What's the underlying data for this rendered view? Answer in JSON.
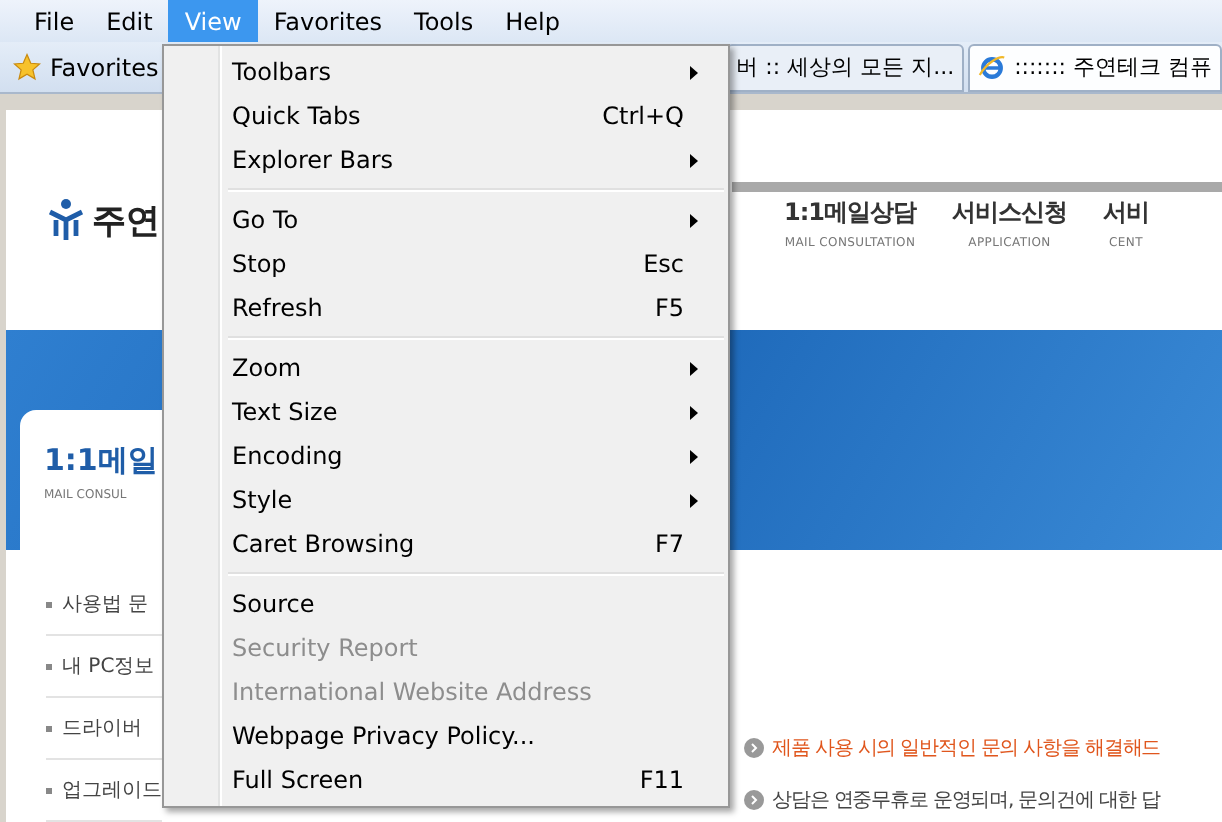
{
  "menu_bar": [
    {
      "label": "File",
      "selected": false
    },
    {
      "label": "Edit",
      "selected": false
    },
    {
      "label": "View",
      "selected": true
    },
    {
      "label": "Favorites",
      "selected": false
    },
    {
      "label": "Tools",
      "selected": false
    },
    {
      "label": "Help",
      "selected": false
    }
  ],
  "favorites_bar": {
    "label": "Favorites"
  },
  "tabs": [
    {
      "title": "버 :: 세상의 모든 지...",
      "selected": false
    },
    {
      "title": "::::::: 주연테크 컴퓨",
      "selected": true
    }
  ],
  "page": {
    "logo": "주연",
    "nav": [
      {
        "title": "1:1메일상담",
        "subtitle": "MAIL CONSULTATION"
      },
      {
        "title": "서비스신청",
        "subtitle": "APPLICATION"
      },
      {
        "title": "서비",
        "subtitle": "CENT"
      }
    ],
    "side_title": "1:1메일",
    "side_subtitle": "MAIL CONSUL",
    "side_links": [
      "사용법 문",
      "내 PC정보",
      "드라이버",
      "업그레이드"
    ],
    "notices": [
      {
        "text": "제품 사용 시의 일반적인 문의 사항을 해결해드",
        "highlight": true
      },
      {
        "text": "상담은 연중무휴로 운영되며, 문의건에 대한 답",
        "highlight": false
      }
    ]
  },
  "view_menu": [
    [
      {
        "label": "Toolbars",
        "submenu": true,
        "disabled": false
      },
      {
        "label": "Quick Tabs",
        "shortcut": "Ctrl+Q",
        "submenu": false,
        "disabled": false
      },
      {
        "label": "Explorer Bars",
        "submenu": true,
        "disabled": false
      }
    ],
    [
      {
        "label": "Go To",
        "submenu": true,
        "disabled": false
      },
      {
        "label": "Stop",
        "shortcut": "Esc",
        "submenu": false,
        "disabled": false
      },
      {
        "label": "Refresh",
        "shortcut": "F5",
        "submenu": false,
        "disabled": false
      }
    ],
    [
      {
        "label": "Zoom",
        "submenu": true,
        "disabled": false
      },
      {
        "label": "Text Size",
        "submenu": true,
        "disabled": false
      },
      {
        "label": "Encoding",
        "submenu": true,
        "disabled": false
      },
      {
        "label": "Style",
        "submenu": true,
        "disabled": false
      },
      {
        "label": "Caret Browsing",
        "shortcut": "F7",
        "submenu": false,
        "disabled": false
      }
    ],
    [
      {
        "label": "Source",
        "submenu": false,
        "disabled": false
      },
      {
        "label": "Security Report",
        "submenu": false,
        "disabled": true
      },
      {
        "label": "International Website Address",
        "submenu": false,
        "disabled": true
      },
      {
        "label": "Webpage Privacy Policy...",
        "submenu": false,
        "disabled": false
      },
      {
        "label": "Full Screen",
        "shortcut": "F11",
        "submenu": false,
        "disabled": false
      }
    ]
  ]
}
